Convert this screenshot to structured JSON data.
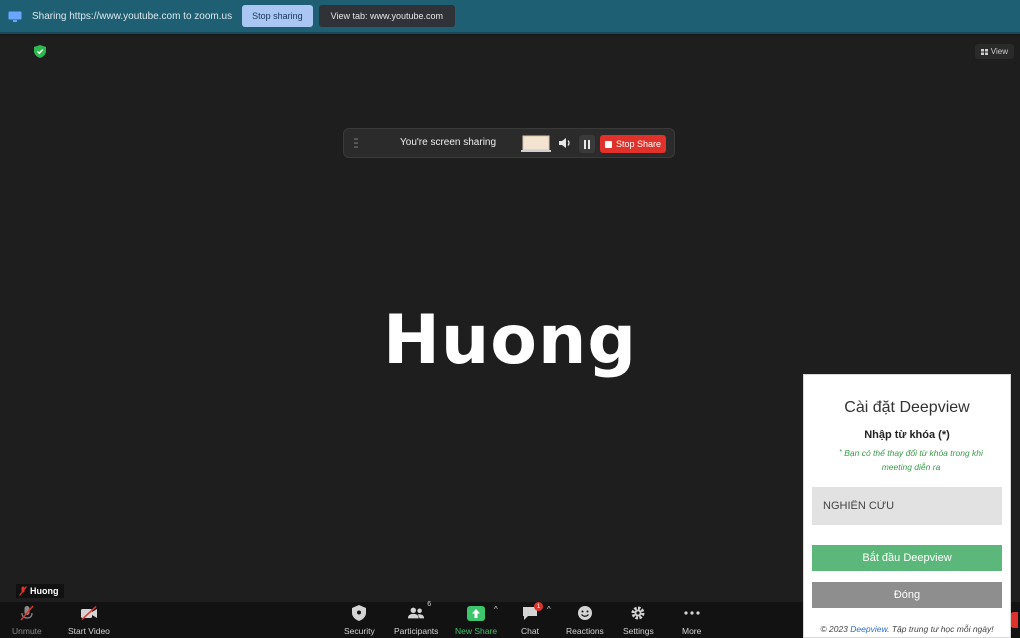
{
  "share_bar": {
    "text": "Sharing https://www.youtube.com to zoom.us",
    "stop_button": "Stop sharing",
    "view_tab_button": "View tab: www.youtube.com",
    "accent": "#1f5f73"
  },
  "meeting": {
    "view_button": "View",
    "pill": {
      "text": "You're screen sharing",
      "stop_share": "Stop Share"
    },
    "participant_name": "Huong",
    "name_tag": "Huong"
  },
  "toolbar": {
    "unmute": "Unmute",
    "start_video": "Start Video",
    "security": "Security",
    "participants": "Participants",
    "participants_count": "6",
    "new_share": "New Share",
    "chat": "Chat",
    "chat_badge": "1",
    "reactions": "Reactions",
    "settings": "Settings",
    "more": "More"
  },
  "deepview": {
    "title": "Cài đặt Deepview",
    "keyword_label": "Nhập từ khóa (*)",
    "hint": "Bạn có thể thay đổi từ khóa trong khi meeting diễn ra",
    "keyword_value": "NGHIÊN CỨU",
    "start_button": "Bắt đầu Deepview",
    "close_button": "Đóng",
    "footer_prefix": "© 2023 ",
    "footer_link": "Deepview",
    "footer_suffix": ". Tập trung tư học mỗi ngày!",
    "accent": "#5cb87a"
  }
}
